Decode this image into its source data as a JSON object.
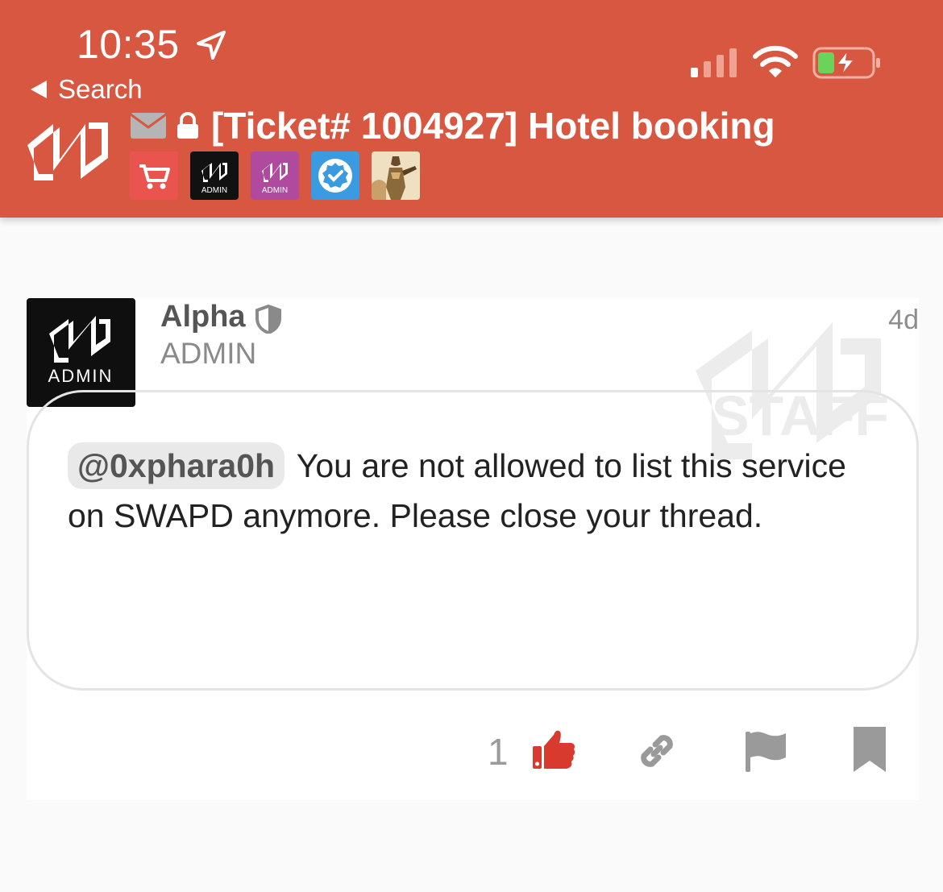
{
  "status_bar": {
    "time": "10:35"
  },
  "nav": {
    "back_label": "Search"
  },
  "topic": {
    "title": "[Ticket# 1004927] Hotel booking"
  },
  "badges": [
    {
      "name": "cart-badge",
      "label": ""
    },
    {
      "name": "admin-badge-black",
      "label": "ADMIN"
    },
    {
      "name": "admin-badge-purple",
      "label": "ADMIN"
    },
    {
      "name": "verified-badge",
      "label": ""
    },
    {
      "name": "pharaoh-badge",
      "label": ""
    }
  ],
  "post": {
    "author": "Alpha",
    "author_title": "ADMIN",
    "age": "4d",
    "avatar_label": "ADMIN",
    "watermark": "STAFF",
    "mention": "@0xphara0h",
    "body": " You are not allowed to list this service on SWAPD anymore. Please close your thread.",
    "like_count": "1"
  },
  "colors": {
    "header": "#d85741",
    "accent_red": "#d83a2e",
    "muted_icon": "#9a9a9a"
  }
}
